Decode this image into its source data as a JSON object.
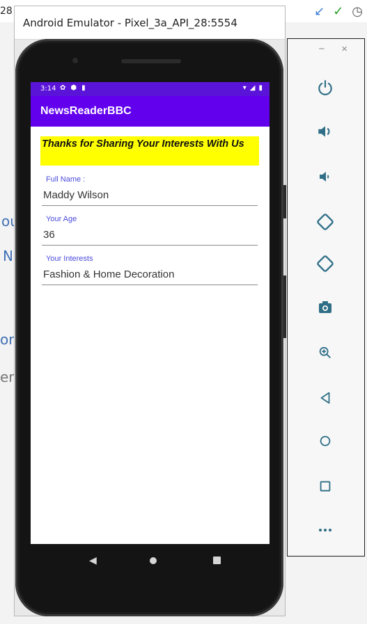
{
  "ide": {
    "left_number": "28",
    "bg_fragments": [
      "ou",
      "N",
      "or",
      "er"
    ]
  },
  "emulator": {
    "title": "Android Emulator - Pixel_3a_API_28:5554"
  },
  "status_bar": {
    "time": "3:14"
  },
  "app": {
    "title": "NewsReaderBBC",
    "banner": "Thanks for Sharing Your Interests With Us",
    "fields": [
      {
        "label": "Full Name :",
        "value": "Maddy Wilson"
      },
      {
        "label": "Your Age",
        "value": "36"
      },
      {
        "label": "Your Interests",
        "value": "Fashion & Home Decoration"
      }
    ]
  },
  "toolbar": {
    "minimize": "−",
    "close": "×",
    "buttons": [
      "power-icon",
      "volume-up-icon",
      "volume-down-icon",
      "rotate-left-icon",
      "rotate-right-icon",
      "camera-icon",
      "zoom-icon",
      "back-icon",
      "home-icon",
      "overview-icon",
      "more-icon"
    ]
  },
  "colors": {
    "status_bar": "#5a14d8",
    "app_bar": "#6200ee",
    "banner": "#ffff00",
    "label": "#4b4bdc",
    "toolbar_icon": "#2e6e86"
  }
}
